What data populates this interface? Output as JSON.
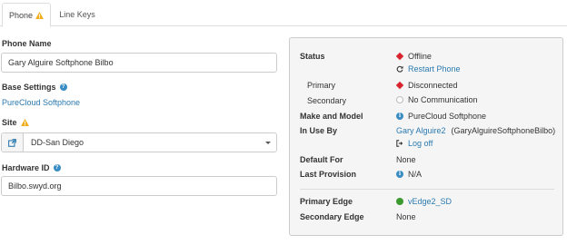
{
  "tabs": [
    {
      "label": "Phone",
      "active": true,
      "warning": true
    },
    {
      "label": "Line Keys",
      "active": false,
      "warning": false
    }
  ],
  "form": {
    "phone_name_label": "Phone Name",
    "phone_name_value": "Gary Alguire Softphone Bilbo",
    "base_settings_label": "Base Settings",
    "base_settings_value": "PureCloud Softphone",
    "site_label": "Site",
    "site_value": "DD-San Diego",
    "hardware_id_label": "Hardware ID",
    "hardware_id_value": "Bilbo.swyd.org"
  },
  "status_panel": {
    "status_label": "Status",
    "status_value": "Offline",
    "restart_label": "Restart Phone",
    "primary_label": "Primary",
    "primary_value": "Disconnected",
    "secondary_label": "Secondary",
    "secondary_value": "No Communication",
    "make_model_label": "Make and Model",
    "make_model_value": "PureCloud Softphone",
    "in_use_by_label": "In Use By",
    "in_use_by_user": "Gary Alguire2",
    "in_use_by_station": "(GaryAlguireSoftphoneBilbo)",
    "logoff_label": "Log off",
    "default_for_label": "Default For",
    "default_for_value": "None",
    "last_provision_label": "Last Provision",
    "last_provision_value": "N/A",
    "primary_edge_label": "Primary Edge",
    "primary_edge_value": "vEdge2_SD",
    "secondary_edge_label": "Secondary Edge",
    "secondary_edge_value": "None"
  },
  "colors": {
    "link": "#2a7ab0",
    "offline": "#d9232e",
    "online": "#3a9a2f",
    "warning": "#f0ad1c"
  }
}
